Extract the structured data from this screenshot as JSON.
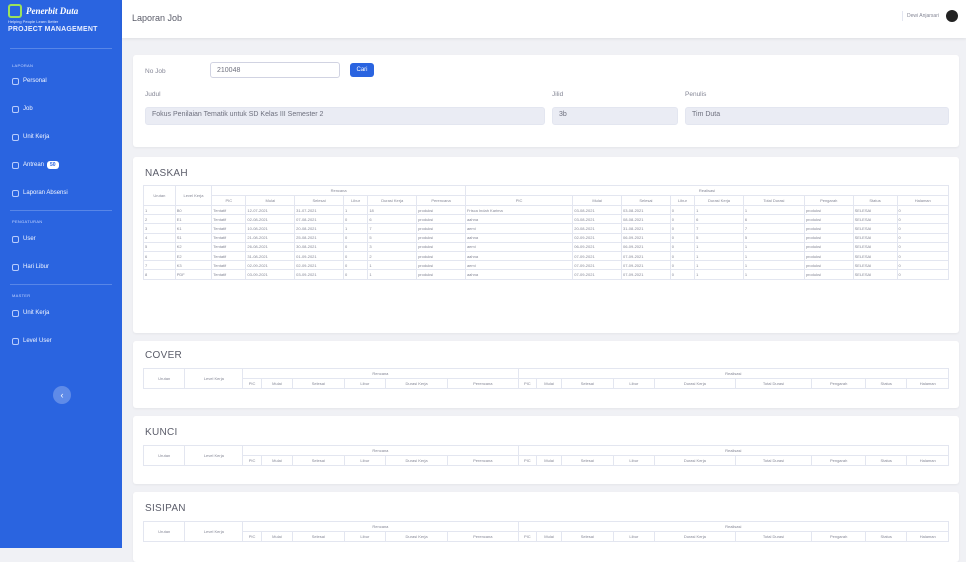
{
  "sidebar": {
    "brand": {
      "name": "Penerbit Duta",
      "tagline": "Helping People Learn Better",
      "subtitle": "PROJECT MANAGEMENT"
    },
    "sections": [
      {
        "title": "LAPORAN",
        "items": [
          {
            "label": "Personal",
            "icon": "clipboard-icon"
          },
          {
            "label": "Job",
            "icon": "tasks-icon"
          },
          {
            "label": "Unit Kerja",
            "icon": "sitemap-icon"
          },
          {
            "label": "Antrean",
            "icon": "list-icon",
            "badge": "50"
          },
          {
            "label": "Laporan Absensi",
            "icon": "calendar-icon"
          }
        ]
      },
      {
        "title": "PENGATURAN",
        "items": [
          {
            "label": "User",
            "icon": "users-icon"
          },
          {
            "label": "Hari Libur",
            "icon": "calendar-icon"
          }
        ]
      },
      {
        "title": "MASTER",
        "items": [
          {
            "label": "Unit Kerja",
            "icon": "sitemap-icon"
          },
          {
            "label": "Level User",
            "icon": "user-cog-icon"
          }
        ]
      }
    ],
    "toggle_icon": "chevron-left-icon"
  },
  "topbar": {
    "title": "Laporan Job",
    "user_name": "Dewi Anjarsari"
  },
  "search": {
    "no_job_label": "No Job",
    "no_job_value": "210048",
    "button_label": "Cari",
    "judul_label": "Judul",
    "judul_value": "Fokus Penilaian Tematik untuk SD Kelas III Semester 2",
    "jilid_label": "Jilid",
    "jilid_value": "3b",
    "penulis_label": "Penulis",
    "penulis_value": "Tim Duta"
  },
  "header_groups": {
    "rencana": "Rencana",
    "realisasi": "Realisasi"
  },
  "naskah": {
    "title": "NASKAH",
    "columns": [
      "Urutan",
      "Level Kerja",
      "PIC",
      "Mulai",
      "Selesai",
      "Libur",
      "Durasi Kerja",
      "Perencana",
      "PIC",
      "Mulai",
      "Selesai",
      "Libur",
      "Durasi Kerja",
      "Total Durasi",
      "Pengarah",
      "Status",
      "Halaman"
    ],
    "rows": [
      [
        "1",
        "B0",
        "Tentatif",
        "12-07-2021",
        "31-07-2021",
        "1",
        "18",
        "produksi",
        "Frisca Indah Karima",
        "03-08-2021",
        "03-08-2021",
        "0",
        "1",
        "1",
        "produksi",
        "SELESAI",
        "0"
      ],
      [
        "2",
        "E1",
        "Tentatif",
        "02-08-2021",
        "07-08-2021",
        "0",
        "6",
        "produksi",
        "aahna",
        "03-08-2021",
        "08-08-2021",
        "0",
        "6",
        "6",
        "produksi",
        "SELESAI",
        "0"
      ],
      [
        "3",
        "K1",
        "Tentatif",
        "10-08-2021",
        "20-08-2021",
        "1",
        "7",
        "produksi",
        "aemi",
        "20-08-2021",
        "31-08-2021",
        "0",
        "7",
        "7",
        "produksi",
        "SELESAI",
        "0"
      ],
      [
        "4",
        "S1",
        "Tentatif",
        "21-08-2021",
        "25-08-2021",
        "0",
        "5",
        "produksi",
        "aahna",
        "02-09-2021",
        "06-09-2021",
        "0",
        "5",
        "5",
        "produksi",
        "SELESAI",
        "0"
      ],
      [
        "5",
        "K2",
        "Tentatif",
        "26-08-2021",
        "30-08-2021",
        "0",
        "3",
        "produksi",
        "aemi",
        "06-09-2021",
        "06-09-2021",
        "0",
        "1",
        "1",
        "produksi",
        "SELESAI",
        "0"
      ],
      [
        "6",
        "E2",
        "Tentatif",
        "31-08-2021",
        "01-09-2021",
        "0",
        "2",
        "produksi",
        "aahna",
        "07-09-2021",
        "07-09-2021",
        "0",
        "1",
        "1",
        "produksi",
        "SELESAI",
        "0"
      ],
      [
        "7",
        "K3",
        "Tentatif",
        "02-09-2021",
        "02-09-2021",
        "0",
        "1",
        "produksi",
        "aemi",
        "07-09-2021",
        "07-09-2021",
        "0",
        "1",
        "1",
        "produksi",
        "SELESAI",
        "0"
      ],
      [
        "8",
        "PDF",
        "Tentatif",
        "03-09-2021",
        "03-09-2021",
        "0",
        "1",
        "produksi",
        "aahna",
        "07-09-2021",
        "07-09-2021",
        "0",
        "1",
        "1",
        "produksi",
        "SELESAI",
        "0"
      ]
    ]
  },
  "cover": {
    "title": "COVER"
  },
  "kunci": {
    "title": "KUNCI"
  },
  "sisipan": {
    "title": "SISIPAN"
  }
}
